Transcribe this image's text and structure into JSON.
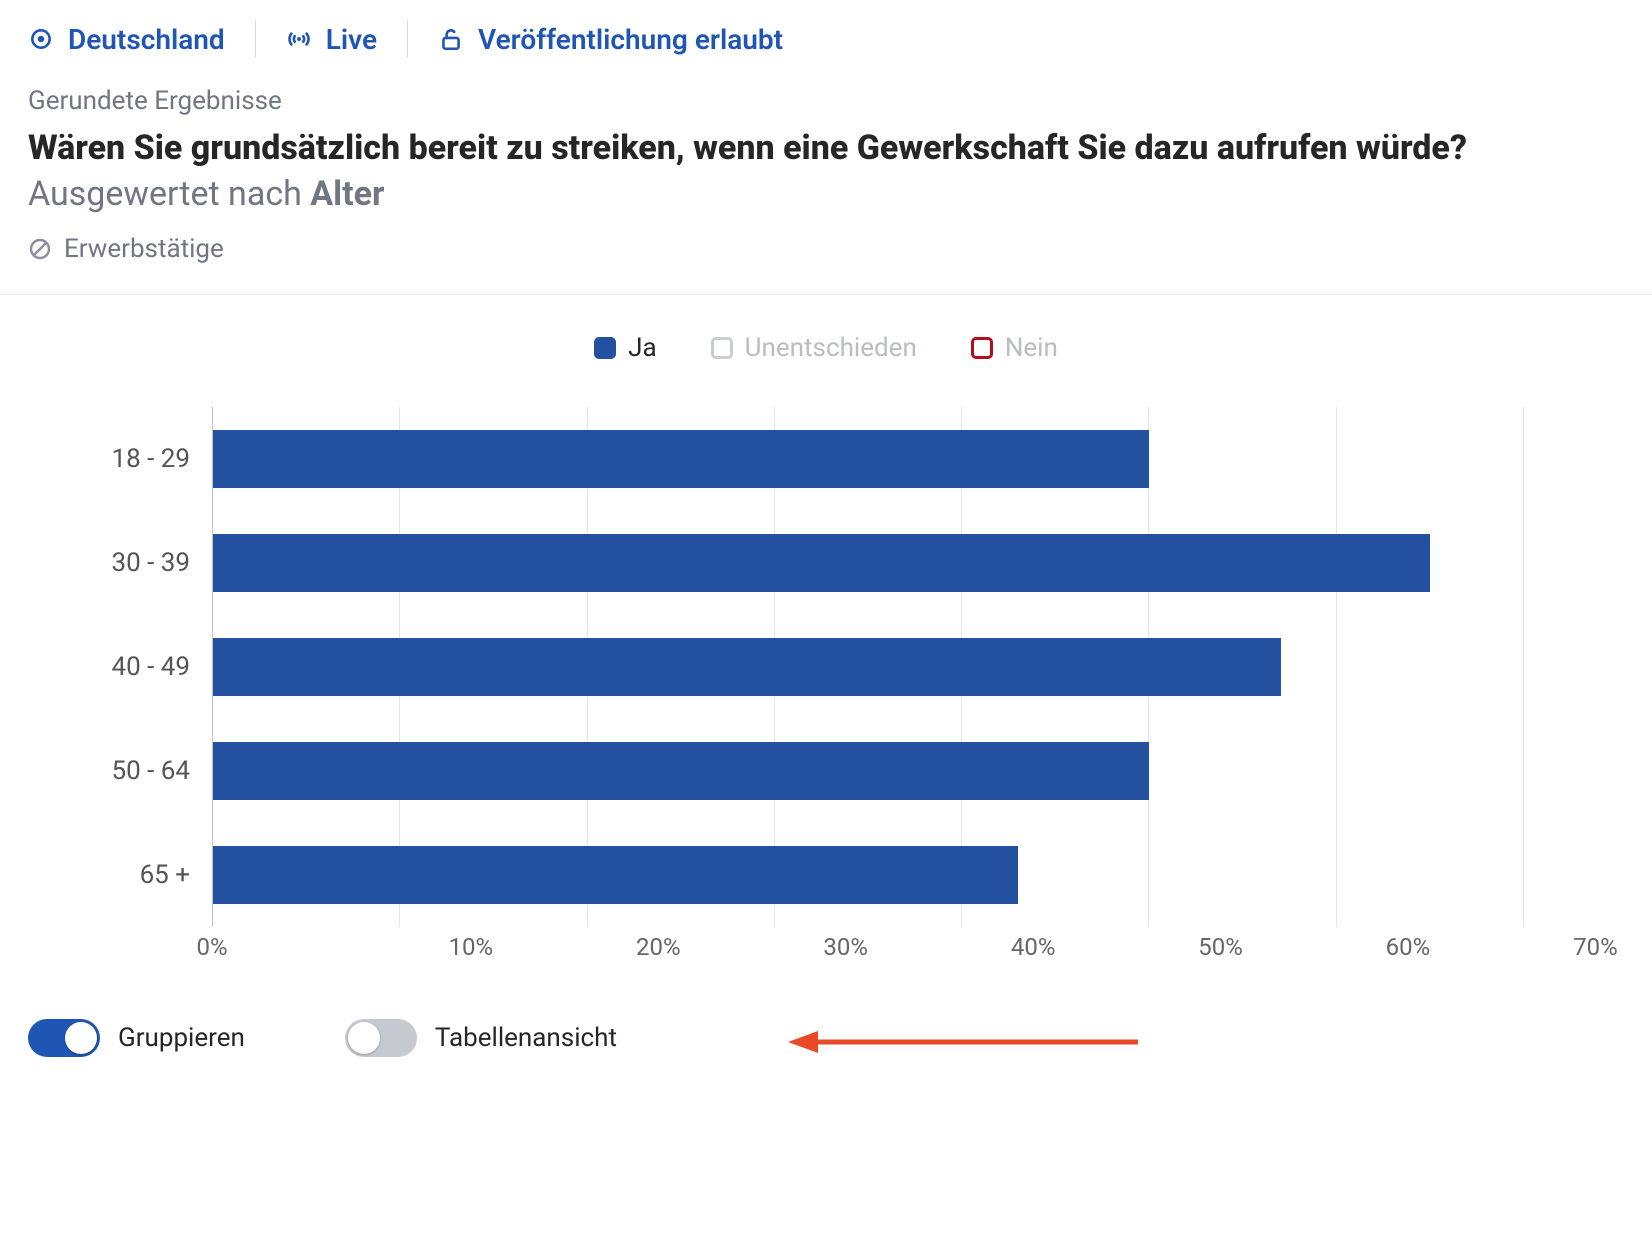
{
  "topbar": {
    "country": "Deutschland",
    "live": "Live",
    "publish": "Veröffentlichung erlaubt"
  },
  "eyebrow": "Gerundete Ergebnisse",
  "headline": {
    "question": "Wären Sie grundsätzlich bereit zu streiken, wenn eine Gewerkschaft Sie dazu aufrufen würde?",
    "analysed_by_prefix": "Ausgewertet nach ",
    "analysed_by_dim": "Alter"
  },
  "filter_label": "Erwerbstätige",
  "legend": {
    "ja": "Ja",
    "un": "Unentschieden",
    "nein": "Nein"
  },
  "toggles": {
    "group": "Gruppieren",
    "table": "Tabellenansicht"
  },
  "chart_data": {
    "type": "bar",
    "orientation": "horizontal",
    "title": "Wären Sie grundsätzlich bereit zu streiken, wenn eine Gewerkschaft Sie dazu aufrufen würde? Ausgewertet nach Alter",
    "xlabel": "",
    "ylabel": "",
    "xlim": [
      0,
      70
    ],
    "x_ticks": [
      0,
      10,
      20,
      30,
      40,
      50,
      60,
      70
    ],
    "x_tick_labels": [
      "0%",
      "10%",
      "20%",
      "30%",
      "40%",
      "50%",
      "60%",
      "70%"
    ],
    "categories": [
      "18 - 29",
      "30 - 39",
      "40 - 49",
      "50 - 64",
      "65 +"
    ],
    "series": [
      {
        "name": "Ja",
        "visible": true,
        "color": "#2351a0",
        "values": [
          50,
          65,
          57,
          50,
          43
        ]
      },
      {
        "name": "Unentschieden",
        "visible": false,
        "color": "#c9cdd3",
        "values": [
          null,
          null,
          null,
          null,
          null
        ]
      },
      {
        "name": "Nein",
        "visible": false,
        "color": "#b30d1a",
        "values": [
          null,
          null,
          null,
          null,
          null
        ]
      }
    ],
    "legend_position": "top"
  }
}
